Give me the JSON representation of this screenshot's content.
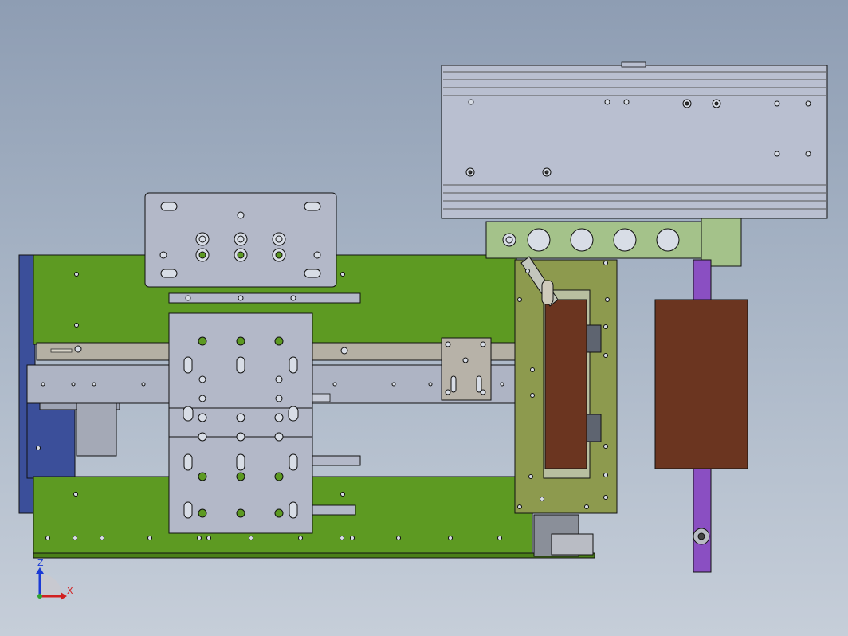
{
  "viewport": {
    "background_top": "#8e9db3",
    "background_bottom": "#c6ced9"
  },
  "colors": {
    "green_plate": "#5d9a22",
    "olive_plate": "#8d9a4e",
    "pale_green_bracket": "#a4c28a",
    "blue_frame": "#3b4f9a",
    "steel_plate": "#b3b8c8",
    "slide_rail": "#b4b0a4",
    "brown_block": "#6b3520",
    "purple_rod": "#8a4fc2",
    "hole_fill": "#d8dde6"
  },
  "triad": {
    "z_label": "Z",
    "x_label": "X",
    "z_color": "#1a3ad6",
    "x_color": "#d11f1f",
    "y_dot_color": "#2fa22f"
  }
}
